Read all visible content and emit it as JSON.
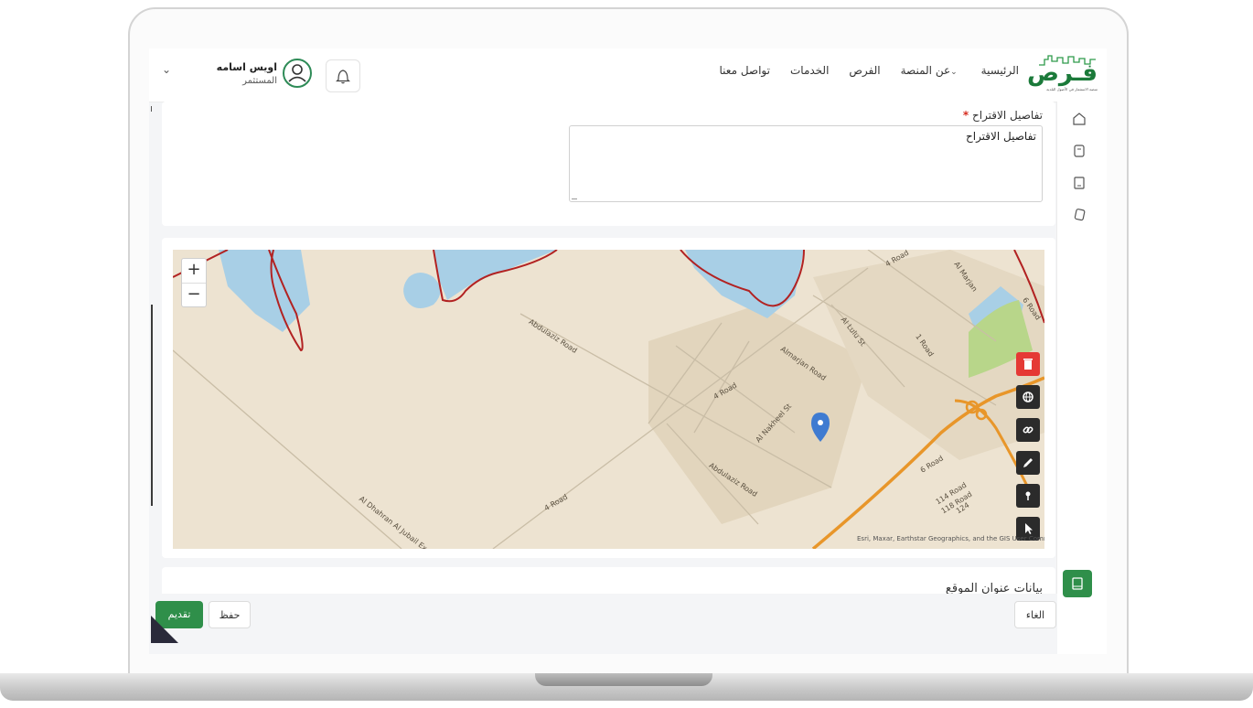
{
  "header": {
    "logo_text": "فـرص",
    "logo_subtitle": "منصة الاستثمار في الأصول البلدية",
    "nav": [
      {
        "label": "الرئيسية"
      },
      {
        "label": "عن المنصة",
        "has_dropdown": true
      },
      {
        "label": "الفرص"
      },
      {
        "label": "الخدمات"
      },
      {
        "label": "تواصل معنا"
      }
    ],
    "user": {
      "name": "اويس اسامه",
      "role": "المستثمر"
    }
  },
  "form": {
    "suggestion_label": "تفاصيل الاقتراح",
    "required_mark": "*",
    "suggestion_value": "تفاصيل الاقتراح"
  },
  "map": {
    "zoom_in": "+",
    "zoom_out": "−",
    "roads": [
      "Abdulaziz Road",
      "Almarjan Road",
      "4 Road",
      "Al Nakheel St",
      "Abdulaziz Road",
      "4 Road",
      "Al Dhahran Al Jubail Ex",
      "Al Lulu St",
      "Al Marjan",
      "1 Road",
      "6 Road",
      "6 Road",
      "114 Road",
      "118 Road",
      "124",
      "4 Road"
    ],
    "attribution": "Esri, Maxar, Earthstar Geographics, and the GIS User Community",
    "tools": [
      "trash-icon",
      "globe-icon",
      "link-icon",
      "pencil-icon",
      "pin-icon",
      "cursor-icon"
    ],
    "colors": {
      "water": "#a8cfe6",
      "land": "#ede3d1",
      "boundary": "#b22222",
      "highway": "#e8962a",
      "marker": "#3f7bd1"
    }
  },
  "location_section": {
    "title": "بيانات عنوان الموقع"
  },
  "footer": {
    "submit": "تقديم",
    "save": "حفظ",
    "cancel": "الغاء"
  }
}
